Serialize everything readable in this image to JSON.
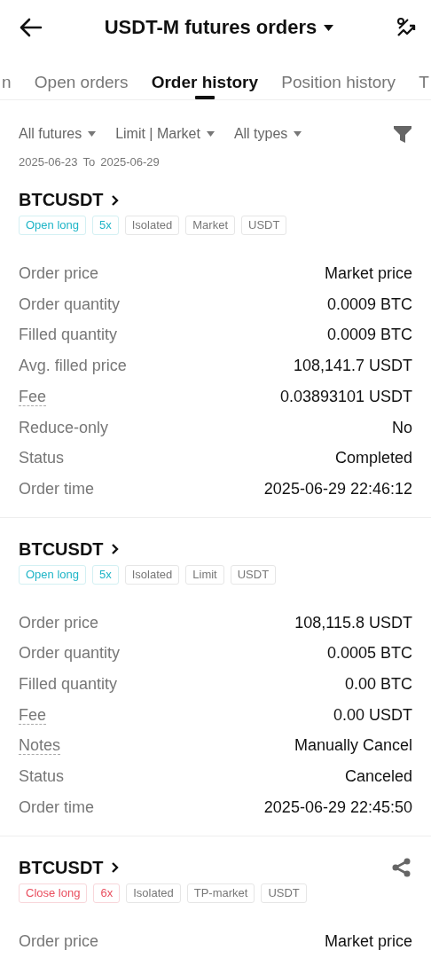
{
  "header": {
    "title": "USDT-M futures orders"
  },
  "tabs": [
    {
      "label": "n",
      "selected": false
    },
    {
      "label": "Open orders",
      "selected": false
    },
    {
      "label": "Order history",
      "selected": true
    },
    {
      "label": "Position history",
      "selected": false
    },
    {
      "label": "T",
      "selected": false
    }
  ],
  "filters": [
    "All futures",
    "Limit | Market",
    "All types"
  ],
  "date_range": {
    "from": "2025-06-23",
    "to_label": "To",
    "to": "2025-06-29"
  },
  "orders": [
    {
      "symbol": "BTCUSDT",
      "shareable": false,
      "tags": [
        {
          "label": "Open long",
          "kind": "buy"
        },
        {
          "label": "5x",
          "kind": "buy"
        },
        {
          "label": "Isolated",
          "kind": "plain"
        },
        {
          "label": "Market",
          "kind": "plain"
        },
        {
          "label": "USDT",
          "kind": "plain"
        }
      ],
      "rows": [
        {
          "label": "Order price",
          "value": "Market price",
          "hint": false
        },
        {
          "label": "Order quantity",
          "value": "0.0009 BTC",
          "hint": false
        },
        {
          "label": "Filled quantity",
          "value": "0.0009 BTC",
          "hint": false
        },
        {
          "label": "Avg. filled price",
          "value": "108,141.7 USDT",
          "hint": false
        },
        {
          "label": "Fee",
          "value": "0.03893101 USDT",
          "hint": true
        },
        {
          "label": "Reduce-only",
          "value": "No",
          "hint": false
        },
        {
          "label": "Status",
          "value": "Completed",
          "hint": false
        },
        {
          "label": "Order time",
          "value": "2025-06-29 22:46:12",
          "hint": false
        }
      ]
    },
    {
      "symbol": "BTCUSDT",
      "shareable": false,
      "tags": [
        {
          "label": "Open long",
          "kind": "buy"
        },
        {
          "label": "5x",
          "kind": "buy"
        },
        {
          "label": "Isolated",
          "kind": "plain"
        },
        {
          "label": "Limit",
          "kind": "plain"
        },
        {
          "label": "USDT",
          "kind": "plain"
        }
      ],
      "rows": [
        {
          "label": "Order price",
          "value": "108,115.8 USDT",
          "hint": false
        },
        {
          "label": "Order quantity",
          "value": "0.0005 BTC",
          "hint": false
        },
        {
          "label": "Filled quantity",
          "value": "0.00 BTC",
          "hint": false
        },
        {
          "label": "Fee",
          "value": "0.00 USDT",
          "hint": true
        },
        {
          "label": "Notes",
          "value": "Manually Cancel",
          "hint": true
        },
        {
          "label": "Status",
          "value": "Canceled",
          "hint": false
        },
        {
          "label": "Order time",
          "value": "2025-06-29 22:45:50",
          "hint": false
        }
      ]
    },
    {
      "symbol": "BTCUSDT",
      "shareable": true,
      "tags": [
        {
          "label": "Close long",
          "kind": "sell"
        },
        {
          "label": "6x",
          "kind": "sell"
        },
        {
          "label": "Isolated",
          "kind": "plain"
        },
        {
          "label": "TP-market",
          "kind": "plain"
        },
        {
          "label": "USDT",
          "kind": "plain"
        }
      ],
      "rows": [
        {
          "label": "Order price",
          "value": "Market price",
          "hint": false
        }
      ]
    }
  ]
}
